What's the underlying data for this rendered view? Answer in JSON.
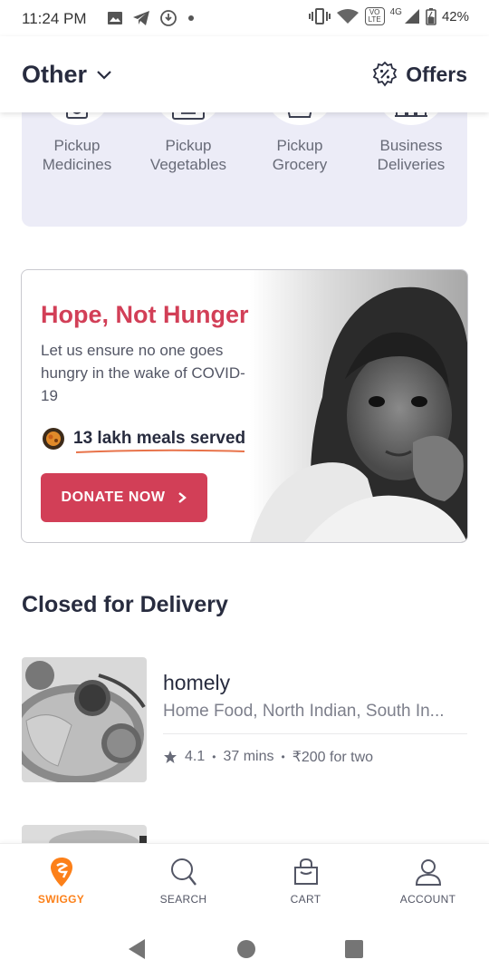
{
  "status_bar": {
    "time": "11:24 PM",
    "network_label": "4G",
    "volte_label": "VO LTE",
    "battery": "42%"
  },
  "header": {
    "location": "Other",
    "offers_label": "Offers"
  },
  "genie": {
    "items": [
      {
        "line1": "Pickup",
        "line2": "Medicines",
        "icon": "medicine-bag-icon"
      },
      {
        "line1": "Pickup",
        "line2": "Vegetables",
        "icon": "vegetable-crate-icon"
      },
      {
        "line1": "Pickup",
        "line2": "Grocery",
        "icon": "grocery-basket-icon"
      },
      {
        "line1": "Business",
        "line2": "Deliveries",
        "icon": "business-building-icon"
      }
    ]
  },
  "donation": {
    "title": "Hope, Not Hunger",
    "description": "Let us ensure no one goes hungry in the wake of COVID-19",
    "meals": "13 lakh meals served",
    "button_label": "DONATE NOW"
  },
  "section": {
    "title": "Closed for Delivery"
  },
  "restaurant": {
    "name": "homely",
    "cuisine": "Home Food, North Indian, South In...",
    "rating": "4.1",
    "time": "37 mins",
    "price": "₹200 for two"
  },
  "bottom_nav": {
    "items": [
      {
        "label": "SWIGGY",
        "icon": "swiggy-logo-icon",
        "active": true
      },
      {
        "label": "SEARCH",
        "icon": "search-icon",
        "active": false
      },
      {
        "label": "CART",
        "icon": "cart-bag-icon",
        "active": false
      },
      {
        "label": "ACCOUNT",
        "icon": "account-icon",
        "active": false
      }
    ]
  },
  "colors": {
    "brand_orange": "#fc8019",
    "donate_pink": "#d23f57",
    "genie_bg": "#ececf7"
  }
}
